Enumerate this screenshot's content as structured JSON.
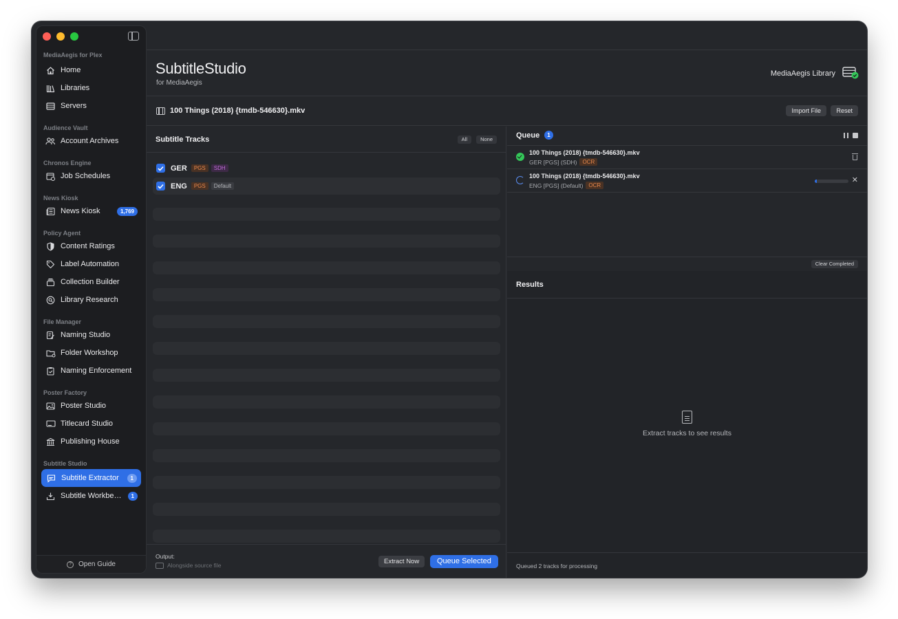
{
  "sidebar": {
    "sections": [
      {
        "title": "MediaAegis for Plex",
        "items": [
          {
            "label": "Home"
          },
          {
            "label": "Libraries"
          },
          {
            "label": "Servers"
          }
        ]
      },
      {
        "title": "Audience Vault",
        "items": [
          {
            "label": "Account Archives"
          }
        ]
      },
      {
        "title": "Chronos Engine",
        "items": [
          {
            "label": "Job Schedules"
          }
        ]
      },
      {
        "title": "News Kiosk",
        "items": [
          {
            "label": "News Kiosk",
            "badge": "1,769"
          }
        ]
      },
      {
        "title": "Policy Agent",
        "items": [
          {
            "label": "Content Ratings"
          },
          {
            "label": "Label Automation"
          },
          {
            "label": "Collection Builder"
          },
          {
            "label": "Library Research"
          }
        ]
      },
      {
        "title": "File Manager",
        "items": [
          {
            "label": "Naming Studio"
          },
          {
            "label": "Folder Workshop"
          },
          {
            "label": "Naming Enforcement"
          }
        ]
      },
      {
        "title": "Poster Factory",
        "items": [
          {
            "label": "Poster Studio"
          },
          {
            "label": "Titlecard Studio"
          },
          {
            "label": "Publishing House"
          }
        ]
      },
      {
        "title": "Subtitle Studio",
        "items": [
          {
            "label": "Subtitle Extractor",
            "badge": "1"
          },
          {
            "label": "Subtitle Workbe…",
            "badge": "1"
          }
        ]
      }
    ],
    "footer_label": "Open Guide"
  },
  "header": {
    "title": "SubtitleStudio",
    "subtitle": "for MediaAegis",
    "library_label": "MediaAegis Library"
  },
  "file": {
    "name": "100 Things (2018) {tmdb-546630}.mkv",
    "import_label": "Import File",
    "reset_label": "Reset"
  },
  "tracks_panel": {
    "title": "Subtitle Tracks",
    "all_label": "All",
    "none_label": "None",
    "tracks": [
      {
        "lang": "GER",
        "tags": [
          "PGS",
          "SDH"
        ],
        "checked": true
      },
      {
        "lang": "ENG",
        "tags": [
          "PGS",
          "Default"
        ],
        "checked": true
      }
    ],
    "output_label": "Output:",
    "output_value": "Alongside source file",
    "extract_label": "Extract Now",
    "queue_label": "Queue Selected"
  },
  "queue": {
    "title": "Queue",
    "count": "1",
    "items": [
      {
        "name": "100 Things (2018) {tmdb-546630}.mkv",
        "meta": "GER [PGS] (SDH)",
        "tag": "OCR",
        "status": "done"
      },
      {
        "name": "100 Things (2018) {tmdb-546630}.mkv",
        "meta": "ENG [PGS] (Default)",
        "tag": "OCR",
        "status": "running",
        "progress": 0.06
      }
    ],
    "clear_label": "Clear Completed"
  },
  "results": {
    "title": "Results",
    "empty_text": "Extract tracks to see results"
  },
  "status_text": "Queued 2 tracks for processing",
  "colors": {
    "accent": "#2f6fe6",
    "pgs": "#e8884c",
    "sdh": "#c06ad9",
    "success": "#34c759"
  }
}
